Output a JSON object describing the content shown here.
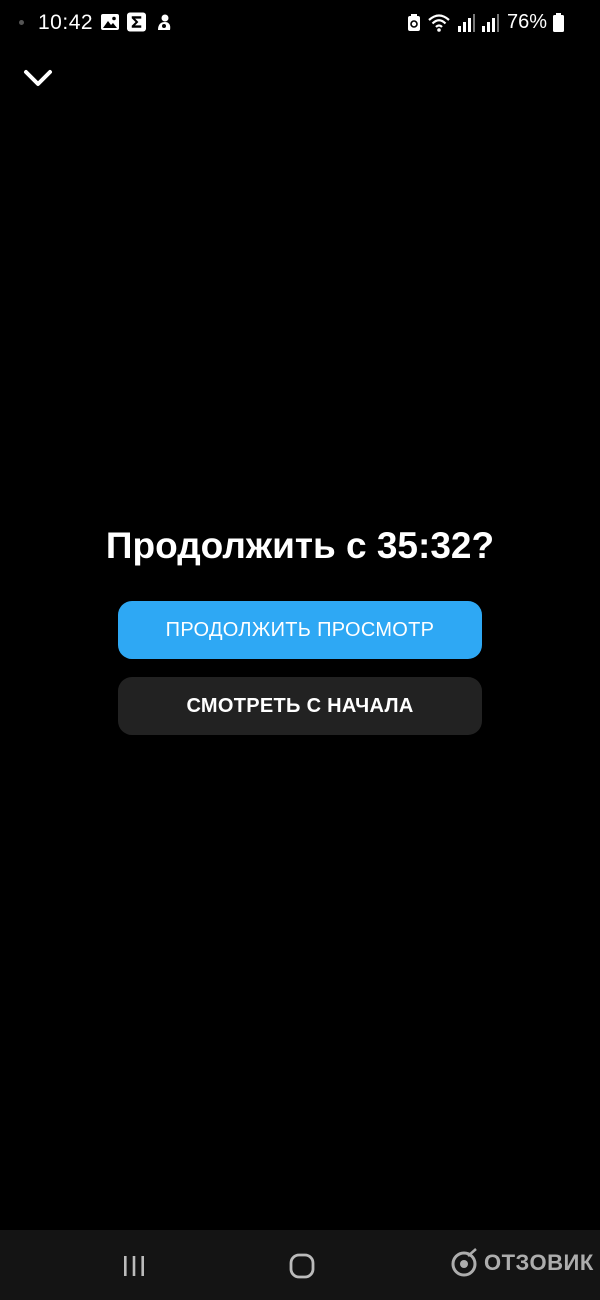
{
  "status_bar": {
    "time": "10:42",
    "battery_percent": "76%",
    "notification_icons": [
      "gallery-icon",
      "sigma-icon",
      "app-icon"
    ],
    "system_icons": [
      "recycle-icon",
      "wifi-icon",
      "signal-icon",
      "signal-icon",
      "battery-icon"
    ]
  },
  "player": {
    "collapse_icon": "chevron-down-icon"
  },
  "resume_dialog": {
    "title": "Продолжить с 35:32?",
    "continue_label": "ПРОДОЛЖИТЬ ПРОСМОТР",
    "restart_label": "СМОТРЕТЬ С НАЧАЛА",
    "continue_color": "#2ea8f4",
    "restart_color": "#222222"
  },
  "nav_bar": {
    "icons": [
      "recents-icon",
      "home-icon"
    ],
    "watermark": "ОТЗОВИК"
  }
}
